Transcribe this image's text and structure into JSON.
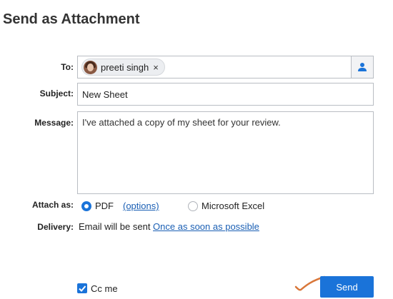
{
  "dialog": {
    "title": "Send as Attachment"
  },
  "labels": {
    "to": "To:",
    "subject": "Subject:",
    "message": "Message:",
    "attach_as": "Attach as:",
    "delivery": "Delivery:"
  },
  "to": {
    "recipients": [
      {
        "name": "preeti singh",
        "remove_symbol": "×"
      }
    ],
    "contacts_icon": "person-icon"
  },
  "subject": {
    "value": "New Sheet"
  },
  "message": {
    "value": "I've attached a copy of my sheet for your review."
  },
  "attach": {
    "options": [
      {
        "label": "PDF",
        "selected": true
      },
      {
        "label": "Microsoft Excel",
        "selected": false
      }
    ],
    "options_link": "(options)"
  },
  "delivery": {
    "text": "Email will be sent ",
    "link": "Once as soon as possible"
  },
  "cc_me": {
    "label": "Cc me",
    "checked": true
  },
  "send": {
    "label": "Send"
  },
  "colors": {
    "accent": "#1a73d9",
    "link": "#1a5fb4",
    "annotation": "#d9773a"
  }
}
